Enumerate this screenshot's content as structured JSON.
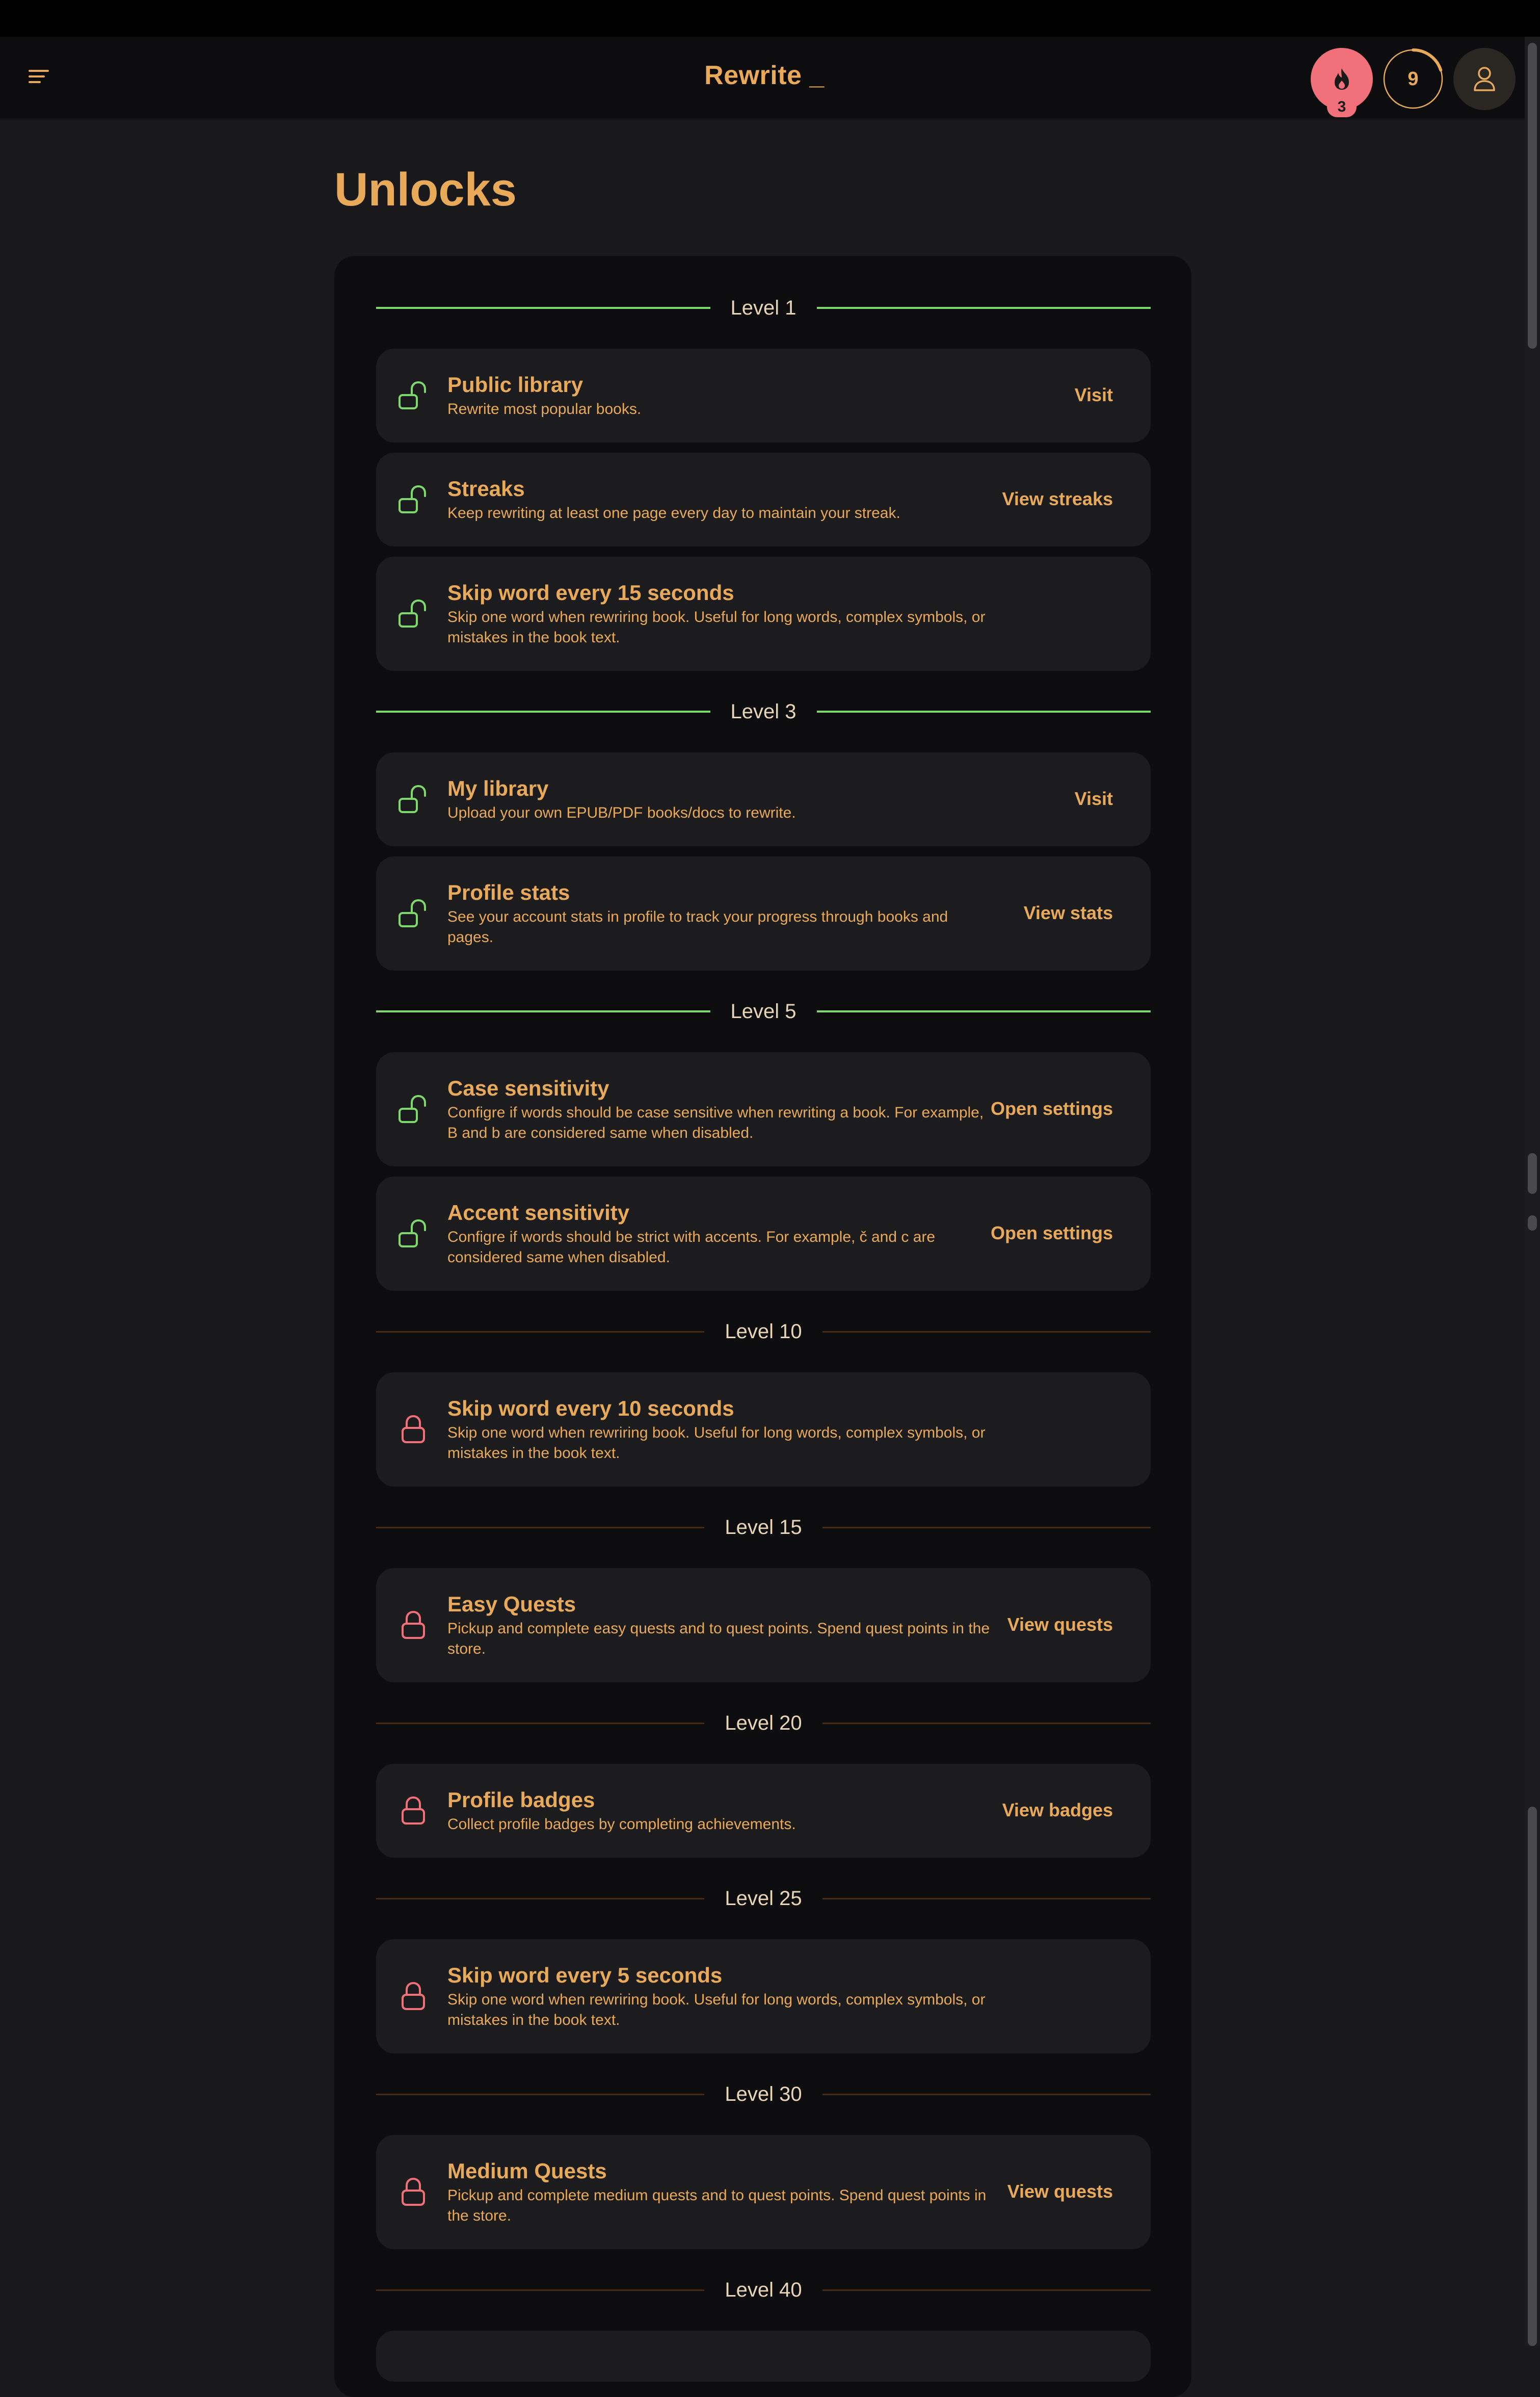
{
  "app": {
    "title": "Rewrite _"
  },
  "header": {
    "streak_count": "3",
    "level": "9",
    "level_progress": 0.2
  },
  "page": {
    "title": "Unlocks"
  },
  "colors": {
    "accent": "#e8a958",
    "unlocked": "#7ed96c",
    "locked": "#f2707a",
    "locked_line": "#4a2a12"
  },
  "levels": [
    {
      "label": "Level 1",
      "unlocked": true
    },
    {
      "label": "Level 3",
      "unlocked": true
    },
    {
      "label": "Level 5",
      "unlocked": true
    },
    {
      "label": "Level 10",
      "unlocked": false
    },
    {
      "label": "Level 15",
      "unlocked": false
    },
    {
      "label": "Level 20",
      "unlocked": false
    },
    {
      "label": "Level 25",
      "unlocked": false
    },
    {
      "label": "Level 30",
      "unlocked": false
    },
    {
      "label": "Level 40",
      "unlocked": false
    }
  ],
  "cards": [
    {
      "title": "Public library",
      "desc": "Rewrite most popular books.",
      "action": "Visit",
      "icon": "lock-open-icon"
    },
    {
      "title": "Streaks",
      "desc": "Keep rewriting at least one page every day to maintain your streak.",
      "action": "View streaks",
      "icon": "lock-open-icon"
    },
    {
      "title": "Skip word every 15 seconds",
      "desc": "Skip one word when rewriring book. Useful for long words, complex symbols, or mistakes in the book text.",
      "action": "",
      "icon": "lock-open-icon"
    },
    {
      "title": "My library",
      "desc": "Upload your own EPUB/PDF books/docs to rewrite.",
      "action": "Visit",
      "icon": "lock-open-icon"
    },
    {
      "title": "Profile stats",
      "desc": "See your account stats in profile to track your progress through books and pages.",
      "action": "View stats",
      "icon": "lock-open-icon"
    },
    {
      "title": "Case sensitivity",
      "desc": "Configre if words should be case sensitive when rewriting a book. For example, B and b are considered same when disabled.",
      "action": "Open settings",
      "icon": "lock-open-icon"
    },
    {
      "title": "Accent sensitivity",
      "desc": "Configre if words should be strict with accents. For example, č and c are considered same when disabled.",
      "action": "Open settings",
      "icon": "lock-open-icon"
    },
    {
      "title": "Skip word every 10 seconds",
      "desc": "Skip one word when rewriring book. Useful for long words, complex symbols, or mistakes in the book text.",
      "action": "",
      "icon": "lock-closed-icon"
    },
    {
      "title": "Easy Quests",
      "desc": "Pickup and complete easy quests and to quest points. Spend quest points in the store.",
      "action": "View quests",
      "icon": "lock-closed-icon"
    },
    {
      "title": "Profile badges",
      "desc": "Collect profile badges by completing achievements.",
      "action": "View badges",
      "icon": "lock-closed-icon"
    },
    {
      "title": "Skip word every 5 seconds",
      "desc": "Skip one word when rewriring book. Useful for long words, complex symbols, or mistakes in the book text.",
      "action": "",
      "icon": "lock-closed-icon"
    },
    {
      "title": "Medium Quests",
      "desc": "Pickup and complete medium quests and to quest points. Spend quest points in the store.",
      "action": "View quests",
      "icon": "lock-closed-icon"
    }
  ]
}
